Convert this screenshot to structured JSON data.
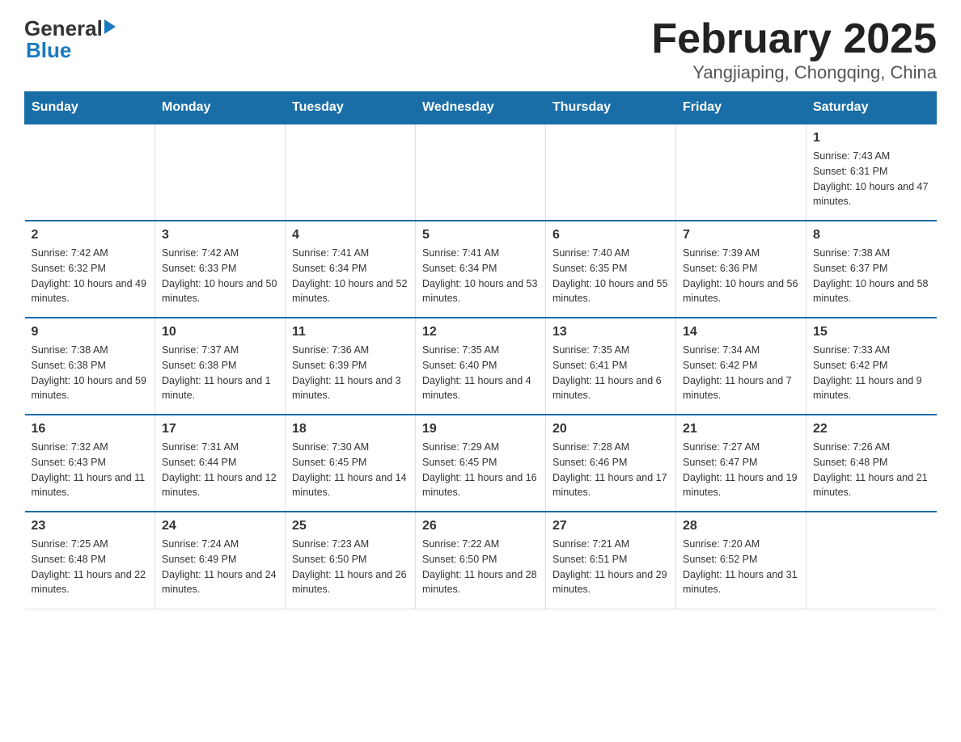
{
  "logo": {
    "text_general": "General",
    "text_blue": "Blue",
    "arrow": "▶"
  },
  "title": "February 2025",
  "subtitle": "Yangjiaping, Chongqing, China",
  "days_of_week": [
    "Sunday",
    "Monday",
    "Tuesday",
    "Wednesday",
    "Thursday",
    "Friday",
    "Saturday"
  ],
  "weeks": [
    [
      {
        "day": "",
        "info": ""
      },
      {
        "day": "",
        "info": ""
      },
      {
        "day": "",
        "info": ""
      },
      {
        "day": "",
        "info": ""
      },
      {
        "day": "",
        "info": ""
      },
      {
        "day": "",
        "info": ""
      },
      {
        "day": "1",
        "info": "Sunrise: 7:43 AM\nSunset: 6:31 PM\nDaylight: 10 hours and 47 minutes."
      }
    ],
    [
      {
        "day": "2",
        "info": "Sunrise: 7:42 AM\nSunset: 6:32 PM\nDaylight: 10 hours and 49 minutes."
      },
      {
        "day": "3",
        "info": "Sunrise: 7:42 AM\nSunset: 6:33 PM\nDaylight: 10 hours and 50 minutes."
      },
      {
        "day": "4",
        "info": "Sunrise: 7:41 AM\nSunset: 6:34 PM\nDaylight: 10 hours and 52 minutes."
      },
      {
        "day": "5",
        "info": "Sunrise: 7:41 AM\nSunset: 6:34 PM\nDaylight: 10 hours and 53 minutes."
      },
      {
        "day": "6",
        "info": "Sunrise: 7:40 AM\nSunset: 6:35 PM\nDaylight: 10 hours and 55 minutes."
      },
      {
        "day": "7",
        "info": "Sunrise: 7:39 AM\nSunset: 6:36 PM\nDaylight: 10 hours and 56 minutes."
      },
      {
        "day": "8",
        "info": "Sunrise: 7:38 AM\nSunset: 6:37 PM\nDaylight: 10 hours and 58 minutes."
      }
    ],
    [
      {
        "day": "9",
        "info": "Sunrise: 7:38 AM\nSunset: 6:38 PM\nDaylight: 10 hours and 59 minutes."
      },
      {
        "day": "10",
        "info": "Sunrise: 7:37 AM\nSunset: 6:38 PM\nDaylight: 11 hours and 1 minute."
      },
      {
        "day": "11",
        "info": "Sunrise: 7:36 AM\nSunset: 6:39 PM\nDaylight: 11 hours and 3 minutes."
      },
      {
        "day": "12",
        "info": "Sunrise: 7:35 AM\nSunset: 6:40 PM\nDaylight: 11 hours and 4 minutes."
      },
      {
        "day": "13",
        "info": "Sunrise: 7:35 AM\nSunset: 6:41 PM\nDaylight: 11 hours and 6 minutes."
      },
      {
        "day": "14",
        "info": "Sunrise: 7:34 AM\nSunset: 6:42 PM\nDaylight: 11 hours and 7 minutes."
      },
      {
        "day": "15",
        "info": "Sunrise: 7:33 AM\nSunset: 6:42 PM\nDaylight: 11 hours and 9 minutes."
      }
    ],
    [
      {
        "day": "16",
        "info": "Sunrise: 7:32 AM\nSunset: 6:43 PM\nDaylight: 11 hours and 11 minutes."
      },
      {
        "day": "17",
        "info": "Sunrise: 7:31 AM\nSunset: 6:44 PM\nDaylight: 11 hours and 12 minutes."
      },
      {
        "day": "18",
        "info": "Sunrise: 7:30 AM\nSunset: 6:45 PM\nDaylight: 11 hours and 14 minutes."
      },
      {
        "day": "19",
        "info": "Sunrise: 7:29 AM\nSunset: 6:45 PM\nDaylight: 11 hours and 16 minutes."
      },
      {
        "day": "20",
        "info": "Sunrise: 7:28 AM\nSunset: 6:46 PM\nDaylight: 11 hours and 17 minutes."
      },
      {
        "day": "21",
        "info": "Sunrise: 7:27 AM\nSunset: 6:47 PM\nDaylight: 11 hours and 19 minutes."
      },
      {
        "day": "22",
        "info": "Sunrise: 7:26 AM\nSunset: 6:48 PM\nDaylight: 11 hours and 21 minutes."
      }
    ],
    [
      {
        "day": "23",
        "info": "Sunrise: 7:25 AM\nSunset: 6:48 PM\nDaylight: 11 hours and 22 minutes."
      },
      {
        "day": "24",
        "info": "Sunrise: 7:24 AM\nSunset: 6:49 PM\nDaylight: 11 hours and 24 minutes."
      },
      {
        "day": "25",
        "info": "Sunrise: 7:23 AM\nSunset: 6:50 PM\nDaylight: 11 hours and 26 minutes."
      },
      {
        "day": "26",
        "info": "Sunrise: 7:22 AM\nSunset: 6:50 PM\nDaylight: 11 hours and 28 minutes."
      },
      {
        "day": "27",
        "info": "Sunrise: 7:21 AM\nSunset: 6:51 PM\nDaylight: 11 hours and 29 minutes."
      },
      {
        "day": "28",
        "info": "Sunrise: 7:20 AM\nSunset: 6:52 PM\nDaylight: 11 hours and 31 minutes."
      },
      {
        "day": "",
        "info": ""
      }
    ]
  ]
}
